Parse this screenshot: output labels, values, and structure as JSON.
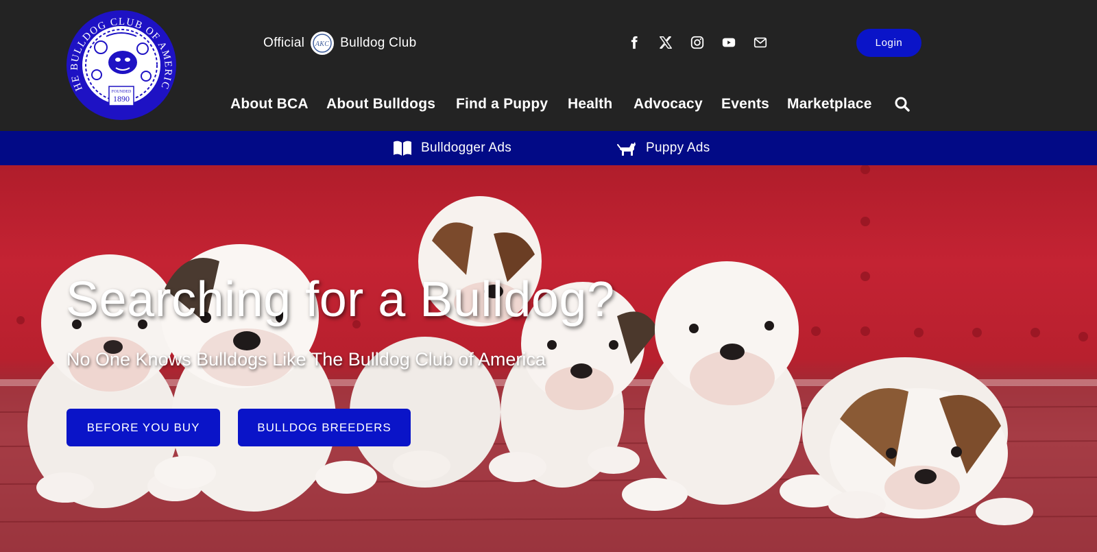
{
  "header": {
    "logo": {
      "ring_text": "THE BULLDOG CLUB OF AMERICA",
      "founded_label": "FOUNDED",
      "founded_year": "1890"
    },
    "official": {
      "prefix": "Official",
      "badge_text": "AKC",
      "suffix": "Bulldog Club"
    },
    "social_icons": [
      "facebook-icon",
      "x-icon",
      "instagram-icon",
      "youtube-icon",
      "email-icon"
    ],
    "login_label": "Login",
    "nav": [
      {
        "label": "About BCA"
      },
      {
        "label": "About Bulldogs"
      },
      {
        "label": "Find a Puppy"
      },
      {
        "label": "Health"
      },
      {
        "label": "Advocacy"
      },
      {
        "label": "Events"
      },
      {
        "label": "Marketplace"
      }
    ],
    "search_icon": "search-icon"
  },
  "subbar": {
    "items": [
      {
        "label": "Bulldogger Ads",
        "icon": "book-icon"
      },
      {
        "label": "Puppy Ads",
        "icon": "dog-icon"
      }
    ]
  },
  "hero": {
    "title": "Searching for a Bulldog?",
    "subtitle": "No One Knows Bulldogs Like The Bulldog Club of America",
    "buttons": [
      {
        "label": "BEFORE YOU BUY"
      },
      {
        "label": "BULLDOG BREEDERS"
      }
    ]
  },
  "colors": {
    "header_bg": "#232323",
    "subbar_bg": "#020a86",
    "accent_blue": "#0a14c8",
    "hero_red": "#c42333"
  }
}
